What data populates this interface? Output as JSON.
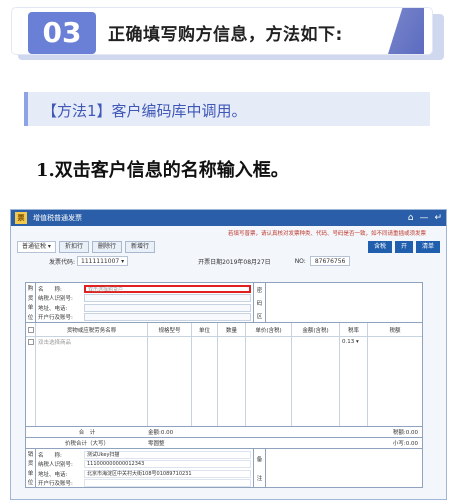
{
  "banner": {
    "number": "03",
    "title": "正确填写购方信息，方法如下:"
  },
  "method": {
    "text": "【方法1】客户编码库中调用。"
  },
  "step": {
    "text": "1.双击客户信息的名称输入框。"
  },
  "window": {
    "title": "增值税普通发票",
    "controls": [
      "⌂",
      "—",
      "↵"
    ],
    "hint": "若填写普票，请认真核对发票种类、代码、号码是否一致，如不同请重插或须发票",
    "invoice_type": "普通征税",
    "toolbar_buttons": [
      "折扣行",
      "删除行",
      "新增行"
    ],
    "right_buttons": [
      "含税",
      "开",
      "清单"
    ],
    "code_label": "发票代码:",
    "code_value": "1111111007",
    "date": "开票日期2019年08月27日",
    "number_label": "NO:",
    "number_value": "87676756"
  },
  "buyer": {
    "side_label": [
      "购",
      "货",
      "单",
      "位"
    ],
    "fields": [
      {
        "label": "名　　称:",
        "value": "双击选择购货户",
        "focus": true
      },
      {
        "label": "纳税人识别号:",
        "value": ""
      },
      {
        "label": "地址、电话:",
        "value": ""
      },
      {
        "label": "开户行及账号:",
        "value": ""
      }
    ],
    "mima_label": [
      "密",
      "码",
      "区"
    ]
  },
  "items": {
    "headers": [
      "货物或应税劳务名称",
      "规格型号",
      "单位",
      "数量",
      "单价(含税)",
      "金额(含税)",
      "税率",
      "税额"
    ],
    "row": {
      "name": "双击选择商品",
      "rate": "0.13"
    }
  },
  "totals": {
    "subtotal_label": "合　计",
    "amount": "金额:0.00",
    "tax": "税额:0.00",
    "total_label": "价税合计（大写）",
    "total_upper": "零圆整",
    "total_lower": "小写:0.00"
  },
  "seller": {
    "side_label": [
      "销",
      "货",
      "单",
      "位"
    ],
    "fields": [
      {
        "label": "名　　称:",
        "value": "测试Ukey扫描"
      },
      {
        "label": "纳税人识别号:",
        "value": "111000000000012343"
      },
      {
        "label": "地址、电话:",
        "value": "北京市海淀区中关村大街108号01089710231"
      },
      {
        "label": "开户行及账号:",
        "value": ""
      }
    ],
    "remark_label": [
      "备",
      "注"
    ]
  }
}
